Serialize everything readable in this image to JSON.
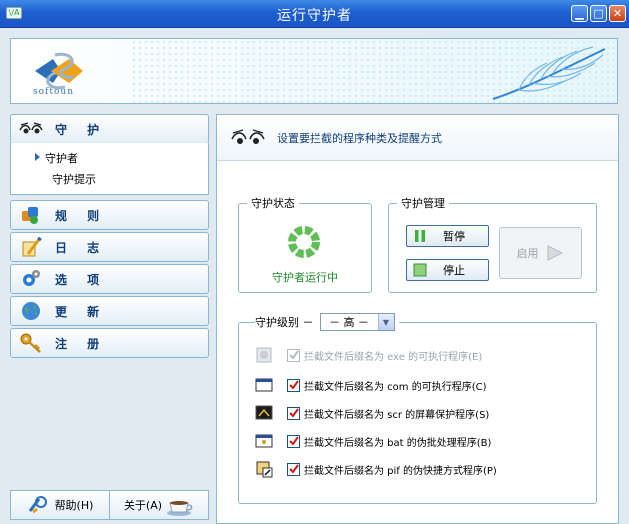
{
  "window": {
    "title": "运行守护者",
    "icon_text": "\\/A"
  },
  "banner": {
    "logo_text": "softoun"
  },
  "nav": {
    "items": [
      {
        "label": "守 护",
        "icon": "eyes-icon"
      },
      {
        "label": "规 则",
        "icon": "rules-icon"
      },
      {
        "label": "日 志",
        "icon": "log-icon"
      },
      {
        "label": "选 项",
        "icon": "options-icon"
      },
      {
        "label": "更 新",
        "icon": "update-globe-icon"
      },
      {
        "label": "注 册",
        "icon": "key-icon"
      }
    ],
    "sub_items": [
      "守护者",
      "守护提示"
    ],
    "help_label": "帮助(H)",
    "about_label": "关于(A)"
  },
  "content": {
    "header": "设置要拦截的程序种类及提醒方式",
    "status_legend": "守护状态",
    "status_text": "守护者运行中",
    "manage_legend": "守护管理",
    "pause_label": "暂停",
    "stop_label": "停止",
    "enable_label": "启用",
    "level_label": "守护级别 －",
    "level_value": "－ 高 －",
    "options": [
      {
        "label": "拦截文件后缀名为 exe 的可执行程序(E)",
        "checked": true,
        "disabled": true
      },
      {
        "label": "拦截文件后缀名为 com 的可执行程序(C)",
        "checked": true,
        "disabled": false
      },
      {
        "label": "拦截文件后缀名为 scr 的屏幕保护程序(S)",
        "checked": true,
        "disabled": false
      },
      {
        "label": "拦截文件后缀名为 bat 的伪批处理程序(B)",
        "checked": true,
        "disabled": false
      },
      {
        "label": "拦截文件后缀名为 pif 的伪快捷方式程序(P)",
        "checked": true,
        "disabled": false
      }
    ]
  },
  "colors": {
    "accent": "#103e7a",
    "status_green": "#1d8a2b",
    "check_red": "#d01818",
    "titlebar": "#1e5fd1"
  }
}
